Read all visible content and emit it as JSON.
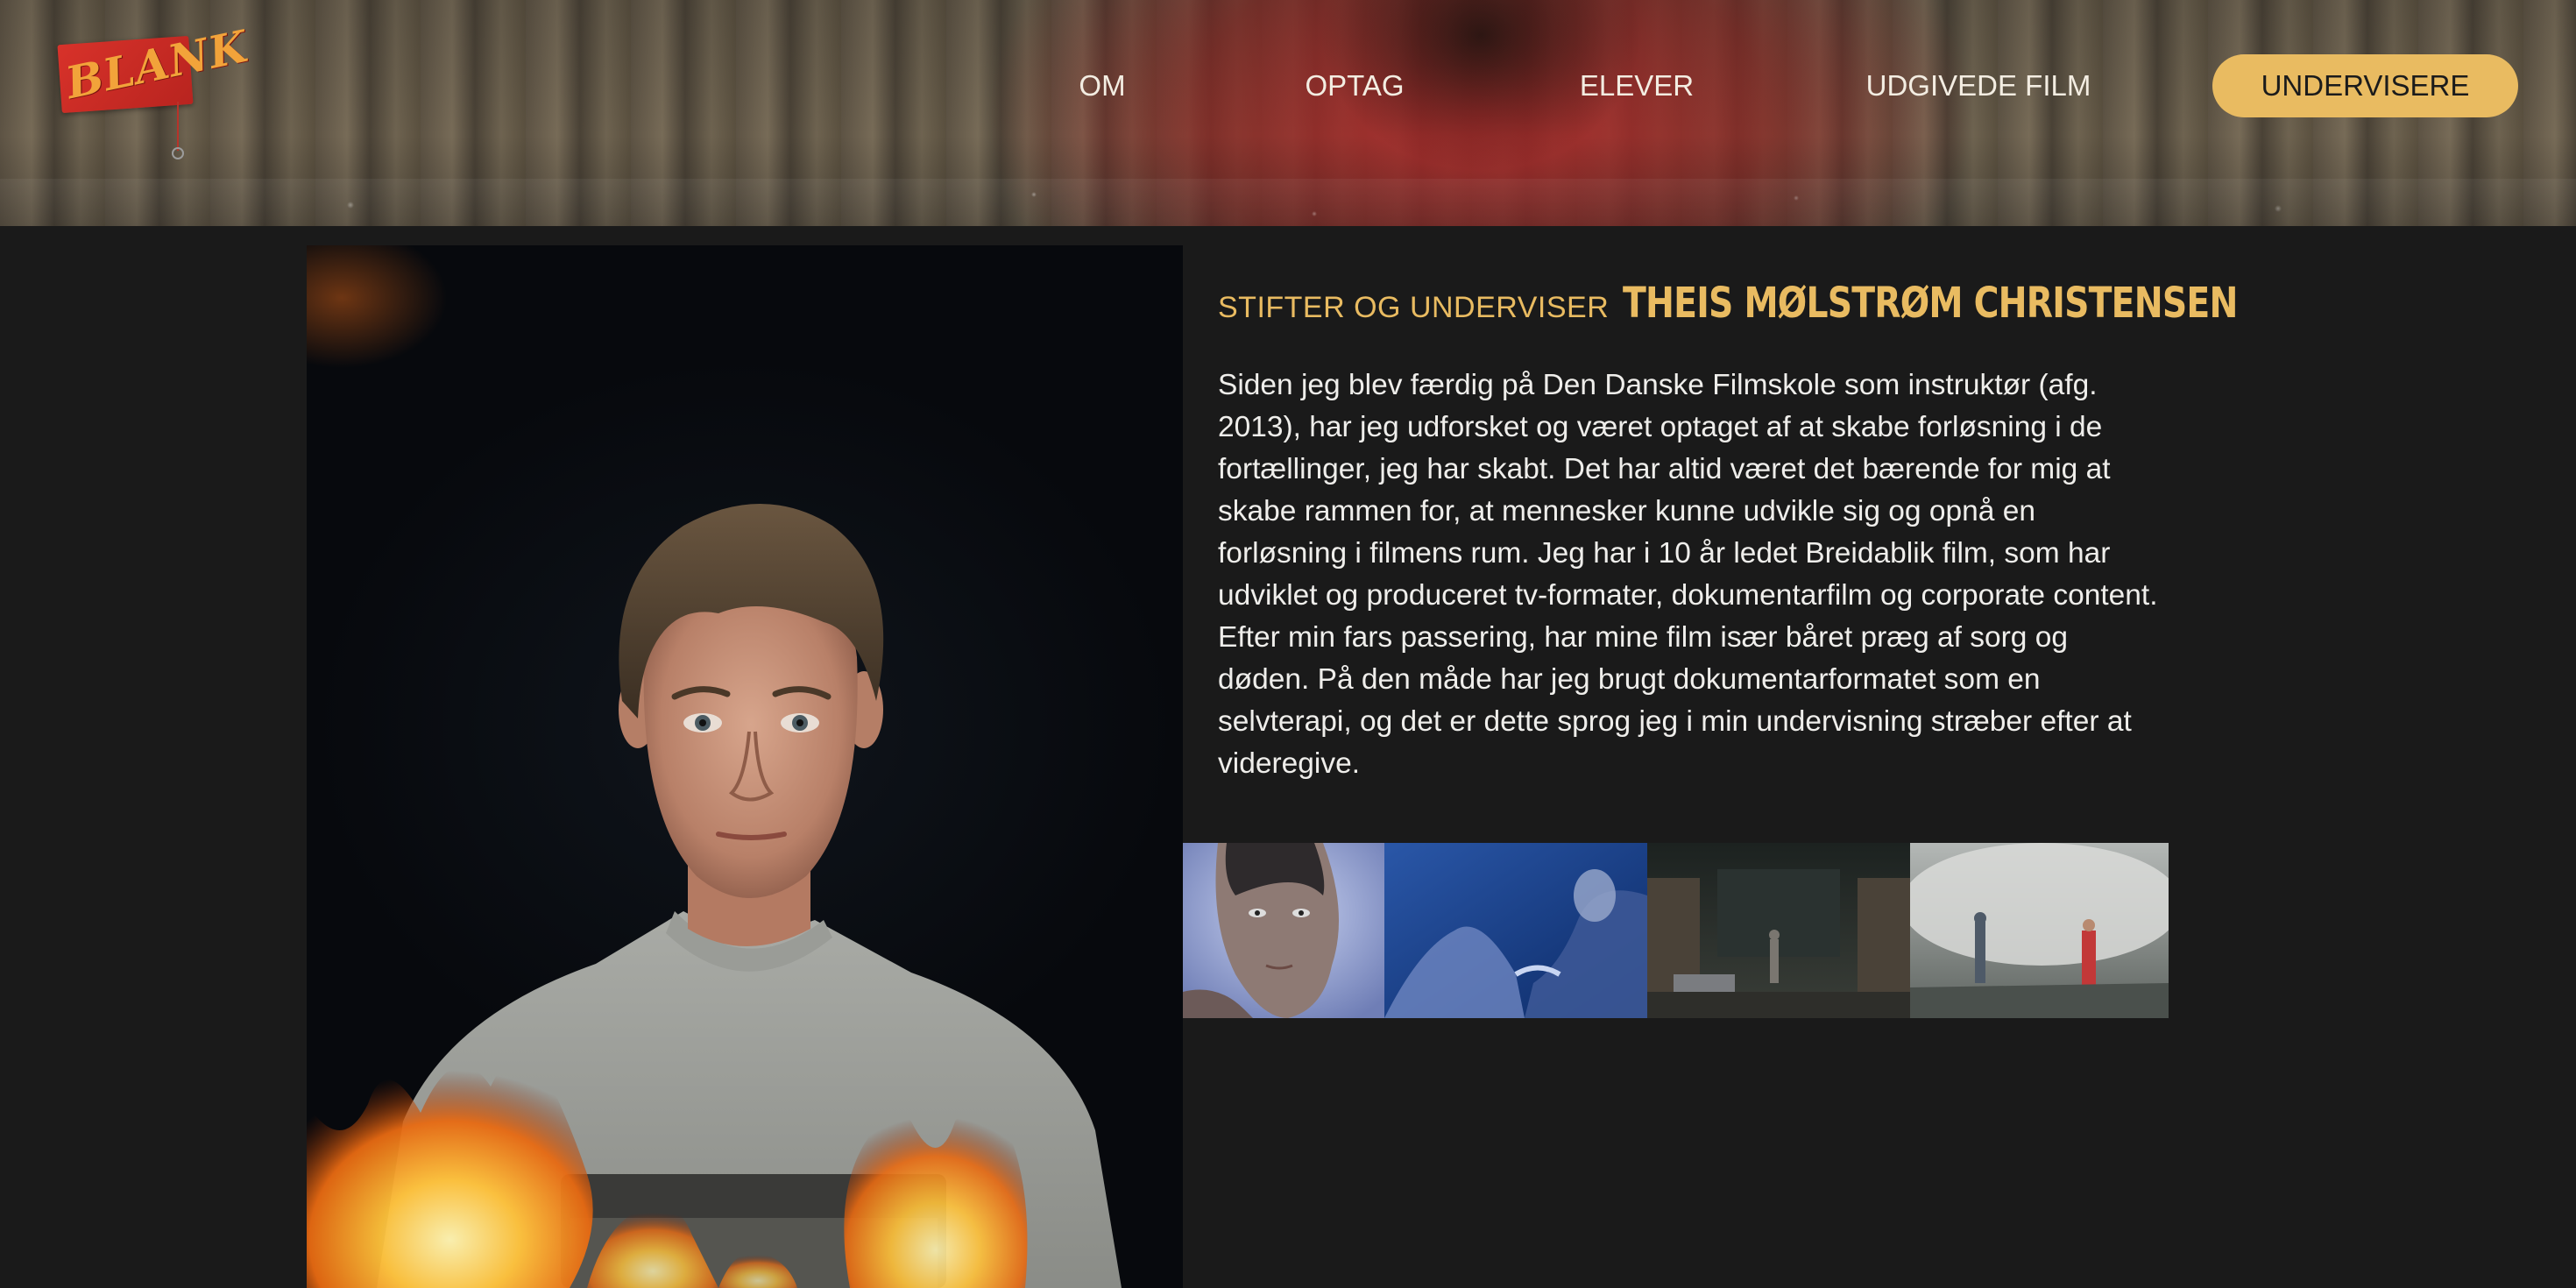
{
  "logo": {
    "text": "BLANK",
    "icon": "blank-logo"
  },
  "nav": {
    "items": [
      {
        "label": "OM"
      },
      {
        "label": "OPTAG"
      },
      {
        "label": "ELEVER"
      },
      {
        "label": "UDGIVEDE FILM"
      }
    ],
    "cta_label": "UNDERVISERE"
  },
  "profile": {
    "role": "STIFTER OG UNDERVISER",
    "name": "THEIS MØLSTRØM CHRISTENSEN",
    "bio": "Siden jeg blev færdig på Den Danske Filmskole som instruktør (afg. 2013), har jeg udforsket og været optaget af at skabe forløsning i de fortællinger, jeg har skabt. Det har altid været det bærende for mig at skabe rammen for, at mennesker kunne udvikle sig og opnå en forløsning i filmens rum. Jeg har i 10 år ledet Breidablik film, som har udviklet og produceret tv-formater, dokumentarfilm og corporate content. Efter min fars passering, har mine film især båret præg af sorg og døden. På den måde har jeg brugt dokumentarformatet som en selvterapi, og det er dette sprog jeg i min undervisning stræber efter at videregive."
  },
  "colors": {
    "accent": "#e9bb61",
    "background": "#1a1a1a",
    "text": "#efeeeb"
  }
}
